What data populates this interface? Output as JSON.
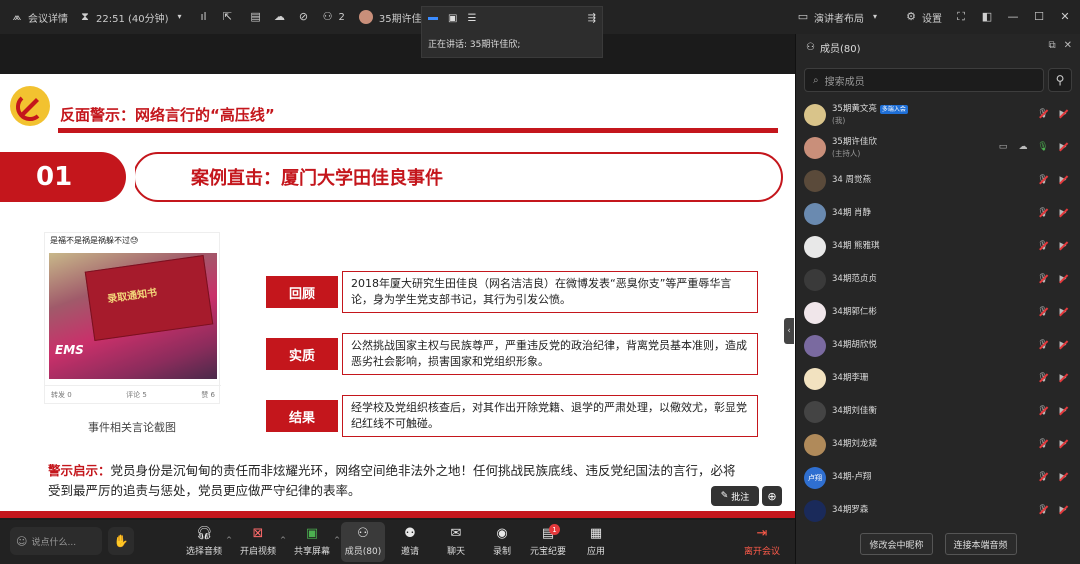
{
  "topbar": {
    "meeting_info": "会议详情",
    "time": "22:51 (40分钟)",
    "participants_count": "2",
    "active_user": "35期许佳欣正",
    "layout_label": "演讲者布局",
    "settings_label": "设置"
  },
  "speaker_pop": {
    "speaking_label": "正在讲话: 35期许佳欣;"
  },
  "slide": {
    "headline": "反面警示：网络言行的“高压线”",
    "number": "01",
    "case_title": "案例直击：厦门大学田佳良事件",
    "card_top_text": "是福不是祸是祸躲不过😓",
    "card_book_text": "录取通知书",
    "card_ems": "EMS",
    "card_foot": [
      "转发 0",
      "评论 5",
      "赞 6"
    ],
    "card_caption": "事件相关言论截图",
    "sections": [
      {
        "tag": "回顾",
        "text": "2018年厦大研究生田佳良（网名洁洁良）在微博发表“恶臭你支”等严重辱华言论，身为学生党支部书记，其行为引发公愤。"
      },
      {
        "tag": "实质",
        "text": "公然挑战国家主权与民族尊严，严重违反党的政治纪律，背离党员基本准则，造成恶劣社会影响，损害国家和党组织形象。"
      },
      {
        "tag": "结果",
        "text": "经学校及党组织核查后，对其作出开除党籍、退学的严肃处理，以儆效尤，彰显党纪红线不可触碰。"
      }
    ],
    "warn_label": "警示启示：",
    "warn_text": "党员身份是沉甸甸的责任而非炫耀光环，网络空间绝非法外之地！任何挑战民族底线、违反党纪国法的言行，必将受到最严厉的追责与惩处，党员更应做严守纪律的表率。"
  },
  "stage_controls": {
    "annotate": "批注"
  },
  "toolbar": {
    "chat_placeholder": "说点什么...",
    "items": [
      {
        "label": "选择音频",
        "icon": "headset-icon"
      },
      {
        "label": "开启视频",
        "icon": "camera-off-icon"
      },
      {
        "label": "共享屏幕",
        "icon": "share-screen-icon"
      },
      {
        "label": "成员(80)",
        "icon": "members-icon"
      },
      {
        "label": "邀请",
        "icon": "invite-icon"
      },
      {
        "label": "聊天",
        "icon": "chat-icon"
      },
      {
        "label": "录制",
        "icon": "record-icon"
      },
      {
        "label": "元宝纪要",
        "icon": "summary-icon",
        "badge": "1"
      },
      {
        "label": "应用",
        "icon": "apps-icon"
      }
    ],
    "leave": "离开会议"
  },
  "panel": {
    "title": "成员(80)",
    "search_placeholder": "搜索成员",
    "members": [
      {
        "name": "35期黄文亮",
        "sub": "(我)",
        "tag": "多端入会",
        "avatar_color": "#d9c48a",
        "avatar_text": ""
      },
      {
        "name": "35期许佳欣",
        "sub": "(主持人)",
        "tag": "",
        "avatar_color": "#c98f7a",
        "avatar_text": "",
        "host": true
      },
      {
        "name": "34   周觉燕",
        "sub": "",
        "tag": "",
        "avatar_color": "#5a4a3a",
        "avatar_text": ""
      },
      {
        "name": "34期 肖静",
        "sub": "",
        "tag": "",
        "avatar_color": "#6a8ab0",
        "avatar_text": ""
      },
      {
        "name": "34期 熊雅琪",
        "sub": "",
        "tag": "",
        "avatar_color": "#e8e8e8",
        "avatar_text": ""
      },
      {
        "name": "34期范贞贞",
        "sub": "",
        "tag": "",
        "avatar_color": "#3a3a3a",
        "avatar_text": ""
      },
      {
        "name": "34期郭仁彬",
        "sub": "",
        "tag": "",
        "avatar_color": "#f0e6ea",
        "avatar_text": ""
      },
      {
        "name": "34期胡欣悦",
        "sub": "",
        "tag": "",
        "avatar_color": "#7a6aa0",
        "avatar_text": ""
      },
      {
        "name": "34期李珊",
        "sub": "",
        "tag": "",
        "avatar_color": "#f2e2c0",
        "avatar_text": ""
      },
      {
        "name": "34期刘佳衡",
        "sub": "",
        "tag": "",
        "avatar_color": "#444",
        "avatar_text": ""
      },
      {
        "name": "34期刘龙斌",
        "sub": "",
        "tag": "",
        "avatar_color": "#b08a5a",
        "avatar_text": ""
      },
      {
        "name": "34期-卢翔",
        "sub": "",
        "tag": "",
        "avatar_color": "#2f6fd0",
        "avatar_text": "卢翔"
      },
      {
        "name": "34期罗森",
        "sub": "",
        "tag": "",
        "avatar_color": "#1a2a5a",
        "avatar_text": ""
      }
    ],
    "rename_button": "修改会中昵称",
    "audio_button": "连接本端音频"
  }
}
